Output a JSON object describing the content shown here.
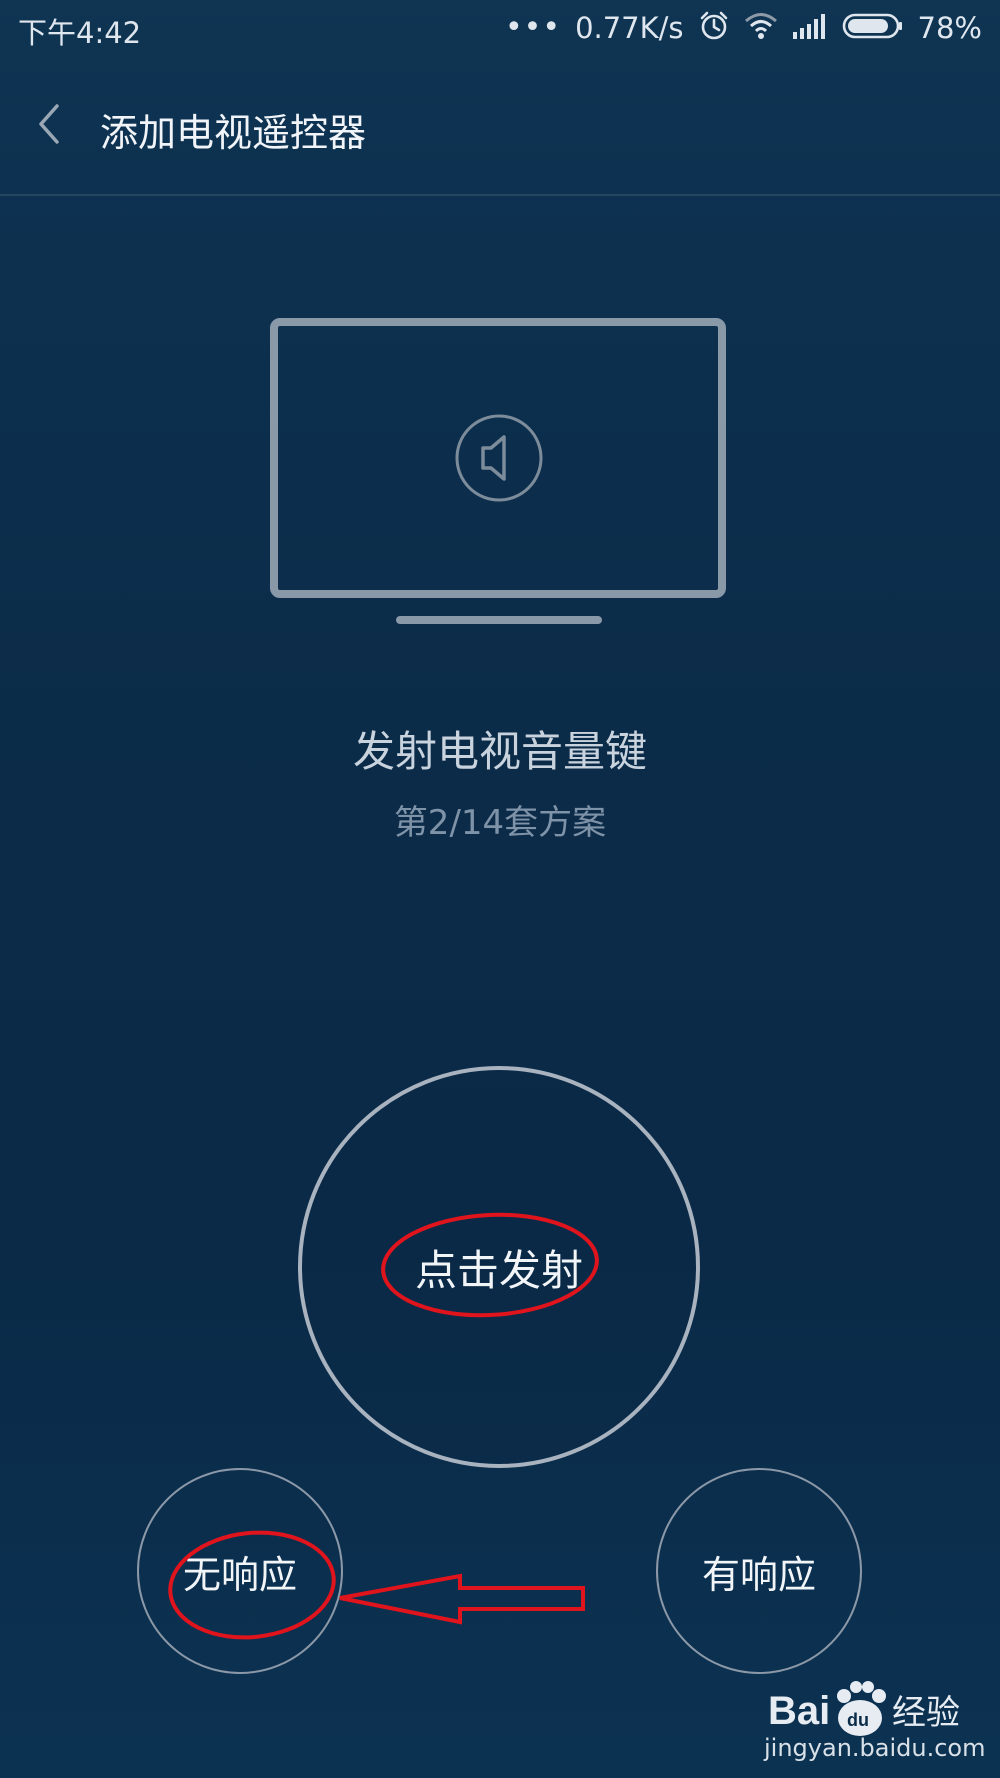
{
  "status_bar": {
    "time": "下午4:42",
    "dots": "•••",
    "network_speed": "0.77K/s",
    "battery_percent": "78%",
    "battery_level": 0.78,
    "icons": [
      "alarm-icon",
      "wifi-icon",
      "signal-icon",
      "battery-icon"
    ]
  },
  "header": {
    "title": "添加电视遥控器",
    "back_icon": "back-arrow-icon"
  },
  "illustration": {
    "icon": "tv-icon",
    "inner_icon": "volume-speaker-icon"
  },
  "status": {
    "main": "发射电视音量键",
    "sub": "第2/14套方案"
  },
  "actions": {
    "fire_label": "点击发射",
    "no_response_label": "无响应",
    "yes_response_label": "有响应"
  },
  "annotations": {
    "color": "#e0141c",
    "marks": [
      "circle-around-fire-label",
      "circle-around-no-response-label",
      "arrow-pointing-to-no-response"
    ]
  },
  "watermark": {
    "brand_text_1": "Bai",
    "brand_text_2": "du",
    "brand_cn": "经验",
    "url": "jingyan.baidu.com"
  },
  "colors": {
    "background_top": "#0f3553",
    "background_mid": "#0a2a47",
    "circle_stroke": "#a8b3bf",
    "muted_text": "#7f93a8"
  }
}
